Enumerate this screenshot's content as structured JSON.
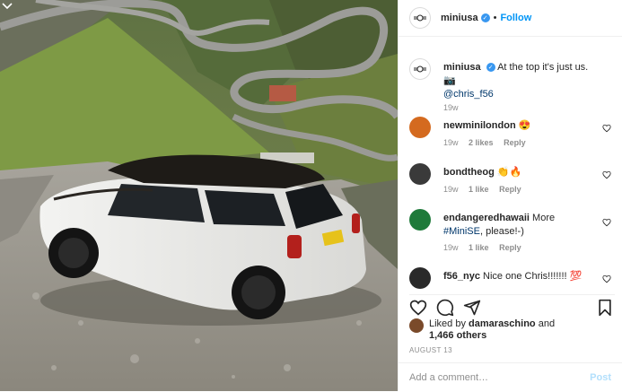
{
  "post": {
    "username": "miniusa",
    "follow_label": "Follow",
    "dot": "•",
    "verified_glyph": "✓"
  },
  "caption": {
    "username": "miniusa",
    "text": "At the top it's just us. 📷",
    "mention": "@chris_f56",
    "time": "19w"
  },
  "comments": [
    {
      "username": "newminilondon",
      "text": "😍",
      "time": "19w",
      "likes": "2 likes",
      "reply": "Reply",
      "avatar_color": "#d46a1f"
    },
    {
      "username": "bondtheog",
      "text": "👏🔥",
      "time": "19w",
      "likes": "1 like",
      "reply": "Reply",
      "avatar_color": "#3a3a3a"
    },
    {
      "username": "endangeredhawaii",
      "text": "More",
      "tag": "#MiniSE",
      "text2": ", please!-)",
      "time": "19w",
      "likes": "1 like",
      "reply": "Reply",
      "avatar_color": "#1e7a3a"
    },
    {
      "username": "f56_nyc",
      "text": "Nice one Chris!!!!!!! 💯",
      "avatar_color": "#2a2a2a"
    }
  ],
  "liked_by": {
    "prefix": "Liked by",
    "user": "damaraschino",
    "and": "and",
    "count": "1,466 others"
  },
  "date": "AUGUST 13",
  "add_comment": {
    "placeholder": "Add a comment…",
    "post_label": "Post"
  },
  "icons": [
    "mini-logo-icon",
    "verified-icon",
    "heart-icon",
    "comment-icon",
    "share-icon",
    "bookmark-icon",
    "chevron-icon"
  ],
  "colors": {
    "accent": "#0095f6",
    "verified": "#3897f0",
    "muted": "#8e8e8e",
    "text": "#262626"
  }
}
